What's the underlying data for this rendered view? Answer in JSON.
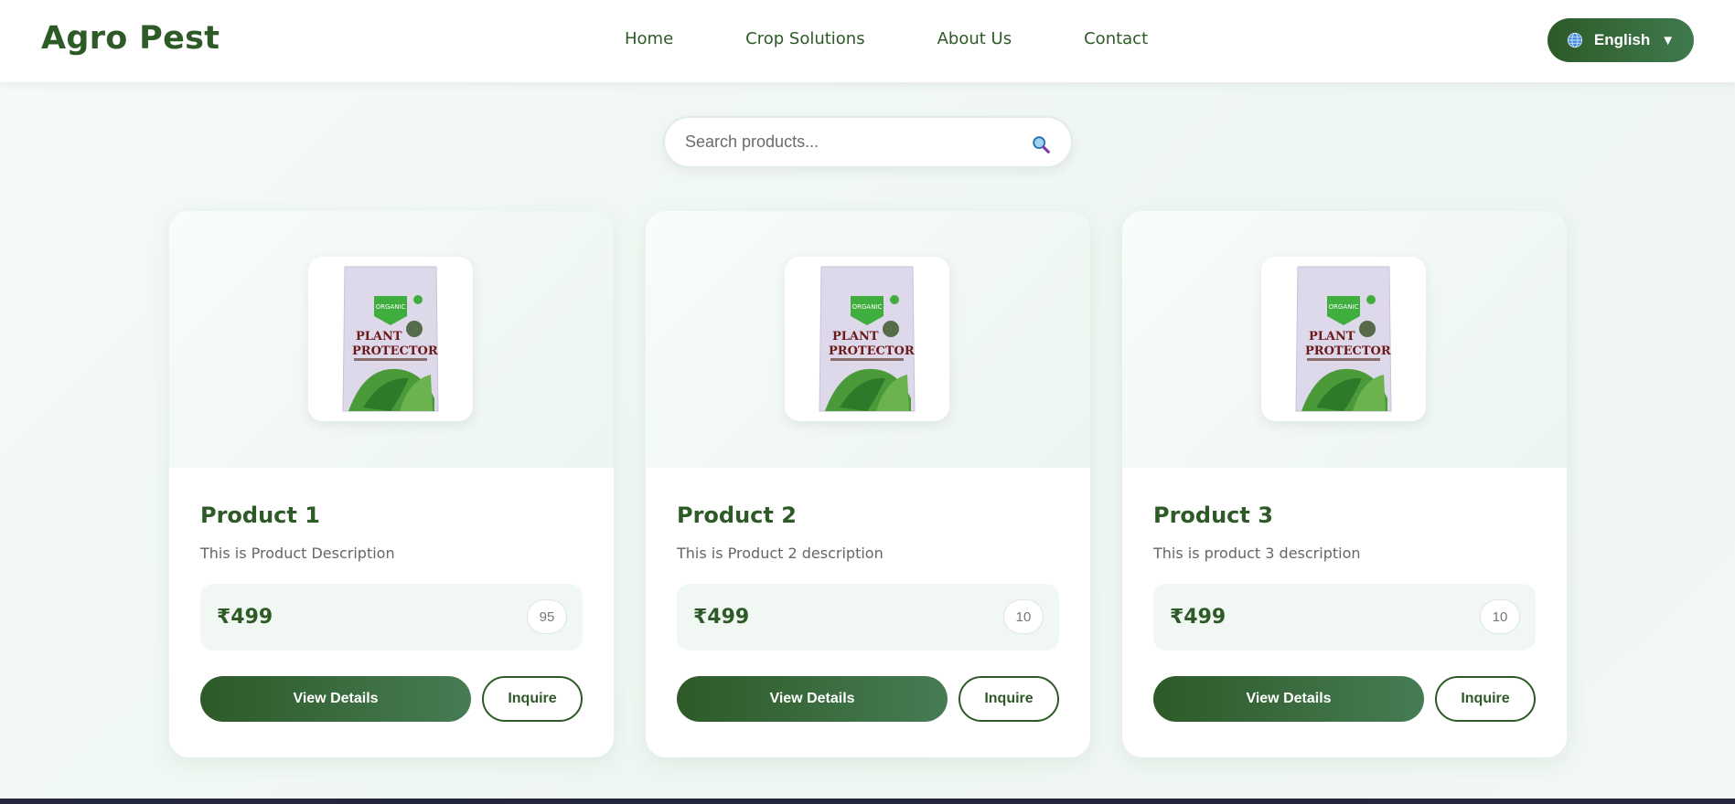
{
  "header": {
    "logo": "Agro Pest",
    "nav": [
      {
        "label": "Home"
      },
      {
        "label": "Crop Solutions"
      },
      {
        "label": "About Us"
      },
      {
        "label": "Contact"
      }
    ],
    "language": {
      "label": "English",
      "icon": "globe-icon",
      "caret": "▼"
    }
  },
  "search": {
    "placeholder": "Search products...",
    "value": "",
    "icon": "search-icon"
  },
  "products": [
    {
      "title": "Product 1",
      "description": "This is Product Description",
      "price": "₹499",
      "stock": "95",
      "view_label": "View Details",
      "inquire_label": "Inquire",
      "image_alt": "Plant Protector package"
    },
    {
      "title": "Product 2",
      "description": "This is Product 2 description",
      "price": "₹499",
      "stock": "10",
      "view_label": "View Details",
      "inquire_label": "Inquire",
      "image_alt": "Plant Protector package"
    },
    {
      "title": "Product 3",
      "description": "This is product 3 description",
      "price": "₹499",
      "stock": "10",
      "view_label": "View Details",
      "inquire_label": "Inquire",
      "image_alt": "Plant Protector package"
    }
  ],
  "colors": {
    "brand": "#2d5a27",
    "accent": "#3f7a4e",
    "bg": "#f4faf7"
  }
}
